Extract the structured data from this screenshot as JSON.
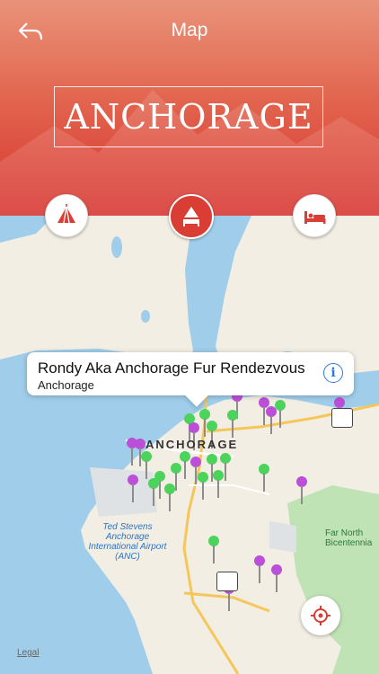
{
  "nav": {
    "title": "Map",
    "back_icon": "back-arrow-icon"
  },
  "banner": {
    "title": "ANCHORAGE"
  },
  "categories": [
    {
      "name": "attractions",
      "icon": "circus-tent-icon",
      "selected": false
    },
    {
      "name": "hotels",
      "icon": "tent-bed-icon",
      "selected": true
    },
    {
      "name": "stay",
      "icon": "bed-icon",
      "selected": false
    }
  ],
  "callout": {
    "title": "Rondy Aka Anchorage Fur Rendezvous",
    "subtitle": "Anchorage",
    "icon": "info-icon"
  },
  "map": {
    "city_label": "ANCHORAGE",
    "airport_label": "Ted Stevens Anchorage International Airport (ANC)",
    "park_label": "Far North Bicentennia",
    "legal": "Legal",
    "colors": {
      "water": "#9fcdea",
      "park": "#bfe3b4",
      "road": "#f5c75a",
      "pin_purple": "#bb4fd8",
      "pin_green": "#4bd35b",
      "accent": "#d93d33"
    }
  }
}
